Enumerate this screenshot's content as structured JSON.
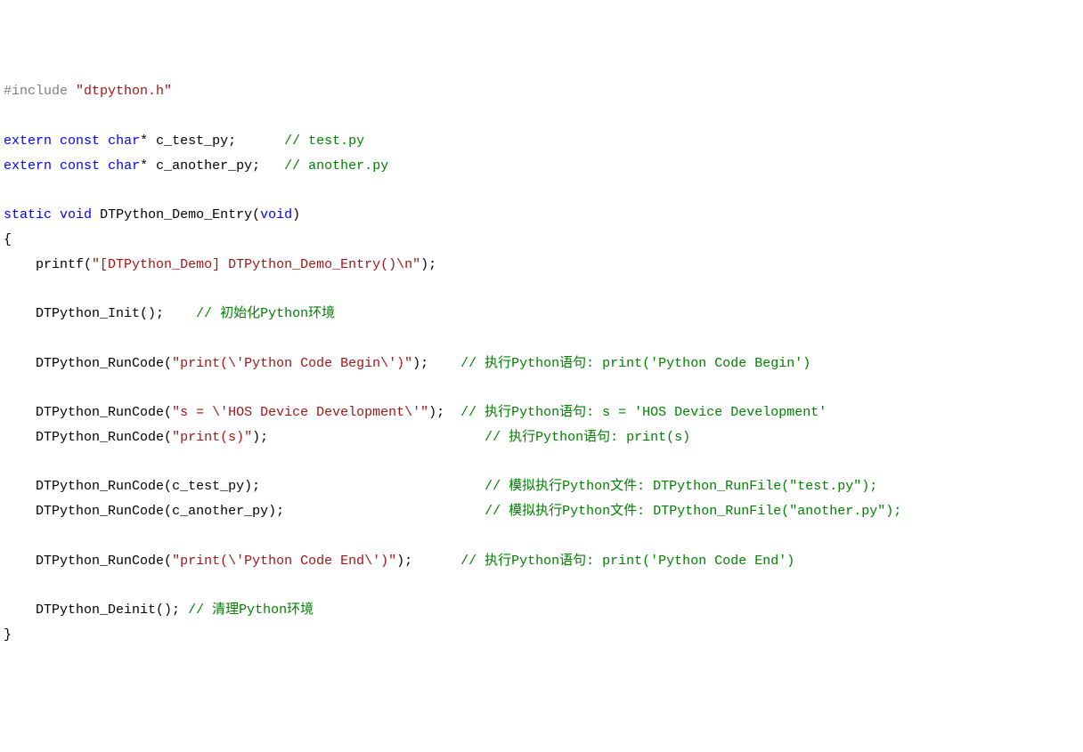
{
  "code": {
    "l01": {
      "pp": "#include",
      "inc": "\"dtpython.h\""
    },
    "l03": {
      "kw1": "extern",
      "kw2": "const",
      "type": "char",
      "star": "*",
      "id": "c_test_py",
      "semi": ";",
      "pad": "      ",
      "cmt": "// test.py"
    },
    "l04": {
      "kw1": "extern",
      "kw2": "const",
      "type": "char",
      "star": "*",
      "id": "c_another_py",
      "semi": ";",
      "pad": "   ",
      "cmt": "// another.py"
    },
    "l06": {
      "kw1": "static",
      "kw2": "void",
      "fn": "DTPython_Demo_Entry",
      "lp": "(",
      "arg": "void",
      "rp": ")"
    },
    "l07": {
      "brace": "{"
    },
    "l08": {
      "indent": "    ",
      "fn": "printf",
      "lp": "(",
      "str": "\"[DTPython_Demo] DTPython_Demo_Entry()\\n\"",
      "rp": ")",
      "semi": ";"
    },
    "l10": {
      "indent": "    ",
      "fn": "DTPython_Init",
      "call": "();",
      "pad": "    ",
      "cmt": "// 初始化Python环境"
    },
    "l12": {
      "indent": "    ",
      "fn": "DTPython_RunCode",
      "lp": "(",
      "str": "\"print(\\'Python Code Begin\\')\"",
      "rp": ")",
      "semi": ";",
      "pad": "    ",
      "cmt": "// 执行Python语句: print('Python Code Begin')"
    },
    "l14": {
      "indent": "    ",
      "fn": "DTPython_RunCode",
      "lp": "(",
      "str": "\"s = \\'HOS Device Development\\'\"",
      "rp": ")",
      "semi": ";",
      "pad": "  ",
      "cmt": "// 执行Python语句: s = 'HOS Device Development'"
    },
    "l15": {
      "indent": "    ",
      "fn": "DTPython_RunCode",
      "lp": "(",
      "str": "\"print(s)\"",
      "rp": ")",
      "semi": ";",
      "pad": "                           ",
      "cmt": "// 执行Python语句: print(s)"
    },
    "l17": {
      "indent": "    ",
      "fn": "DTPython_RunCode",
      "lp": "(",
      "id": "c_test_py",
      "rp": ")",
      "semi": ";",
      "pad": "                            ",
      "cmt": "// 模拟执行Python文件: DTPython_RunFile(\"test.py\");"
    },
    "l18": {
      "indent": "    ",
      "fn": "DTPython_RunCode",
      "lp": "(",
      "id": "c_another_py",
      "rp": ")",
      "semi": ";",
      "pad": "                         ",
      "cmt": "// 模拟执行Python文件: DTPython_RunFile(\"another.py\");"
    },
    "l20": {
      "indent": "    ",
      "fn": "DTPython_RunCode",
      "lp": "(",
      "str": "\"print(\\'Python Code End\\')\"",
      "rp": ")",
      "semi": ";",
      "pad": "      ",
      "cmt": "// 执行Python语句: print('Python Code End')"
    },
    "l22": {
      "indent": "    ",
      "fn": "DTPython_Deinit",
      "call": "();",
      "pad": " ",
      "cmt": "// 清理Python环境"
    },
    "l23": {
      "brace": "}"
    }
  }
}
